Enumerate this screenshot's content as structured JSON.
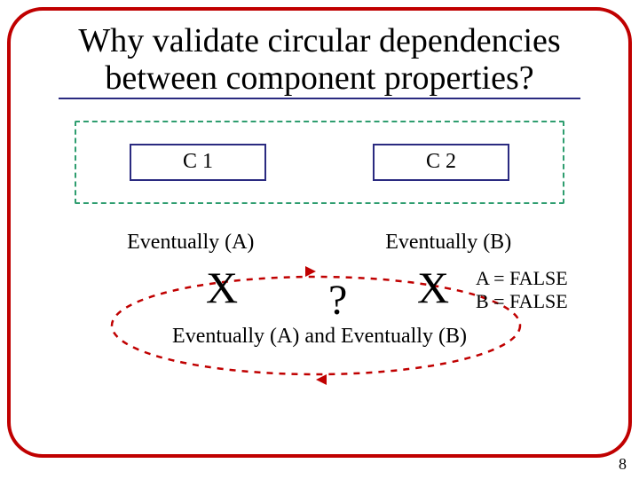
{
  "title": "Why validate circular dependencies between component properties?",
  "components": {
    "c1": "C 1",
    "c2": "C 2"
  },
  "events": {
    "a": "Eventually (A)",
    "b": "Eventually (B)"
  },
  "marks": {
    "x1": "X",
    "x2": "X",
    "q": "?"
  },
  "equality": {
    "a": "A = FALSE",
    "b": "B = FALSE"
  },
  "conjunction": "Eventually (A) and Eventually (B)",
  "page": "8"
}
